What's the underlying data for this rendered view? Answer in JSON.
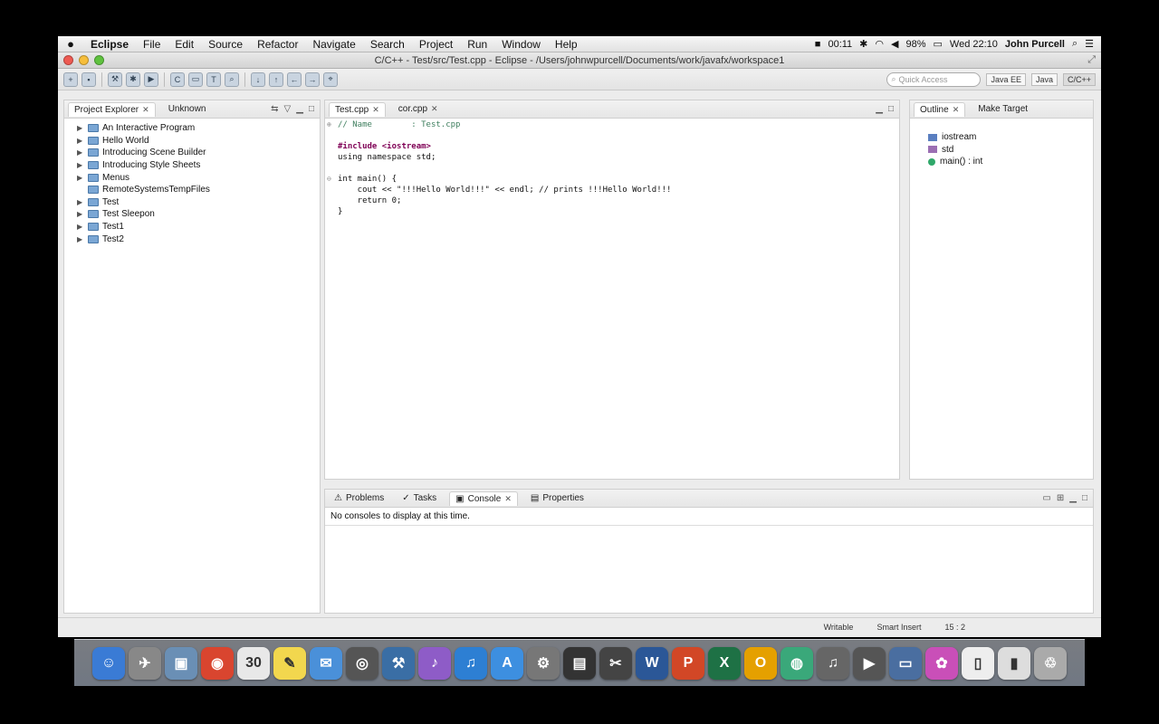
{
  "menubar": {
    "apple": "",
    "items": [
      "Eclipse",
      "File",
      "Edit",
      "Source",
      "Refactor",
      "Navigate",
      "Search",
      "Project",
      "Run",
      "Window",
      "Help"
    ],
    "clock": "00:11",
    "battery": "98%",
    "datetime": "Wed 22:10",
    "user": "John Purcell"
  },
  "window": {
    "title": "C/C++ - Test/src/Test.cpp - Eclipse - /Users/johnwpurcell/Documents/work/javafx/workspace1"
  },
  "toolbar": {
    "quick_access_placeholder": "Quick Access",
    "perspectives": [
      "Java EE",
      "Java",
      "C/C++"
    ]
  },
  "explorer": {
    "tabs": [
      "Project Explorer",
      "Unknown"
    ],
    "items": [
      {
        "label": "An Interactive Program",
        "has_arrow": true
      },
      {
        "label": "Hello World",
        "has_arrow": true
      },
      {
        "label": "Introducing Scene Builder",
        "has_arrow": true
      },
      {
        "label": "Introducing Style Sheets",
        "has_arrow": true
      },
      {
        "label": "Menus",
        "has_arrow": true
      },
      {
        "label": "RemoteSystemsTempFiles",
        "has_arrow": false
      },
      {
        "label": "Test",
        "has_arrow": true
      },
      {
        "label": "Test Sleepon",
        "has_arrow": true
      },
      {
        "label": "Test1",
        "has_arrow": true
      },
      {
        "label": "Test2",
        "has_arrow": true
      }
    ]
  },
  "editor": {
    "tabs": [
      "Test.cpp",
      "cor.cpp"
    ],
    "code": {
      "line1_comment": "// Name        : Test.cpp",
      "include": "#include <iostream>",
      "using": "using namespace std;",
      "main_sig": "int main() {",
      "cout": "    cout << \"!!!Hello World!!!\" << endl; // prints !!!Hello World!!!",
      "return": "    return 0;",
      "close": "}"
    }
  },
  "outline": {
    "tabs": [
      "Outline",
      "Make Target"
    ],
    "items": [
      "iostream",
      "std",
      "main() : int"
    ]
  },
  "console": {
    "tabs": [
      "Problems",
      "Tasks",
      "Console",
      "Properties"
    ],
    "message": "No consoles to display at this time."
  },
  "statusbar": {
    "writable": "Writable",
    "insert": "Smart Insert",
    "position": "15 : 2"
  },
  "dock": {
    "apps": [
      {
        "icon": "finder-icon",
        "color": "#3a7bd5",
        "glyph": "☺"
      },
      {
        "icon": "launchpad-icon",
        "color": "#888888",
        "glyph": "✈"
      },
      {
        "icon": "preview-icon",
        "color": "#6a8fb5",
        "glyph": "▣"
      },
      {
        "icon": "chrome-icon",
        "color": "#d9452f",
        "glyph": "◉"
      },
      {
        "icon": "calendar-icon",
        "color": "#e8e8e8",
        "glyph": "30"
      },
      {
        "icon": "notes-icon",
        "color": "#f2d74e",
        "glyph": "✎"
      },
      {
        "icon": "mail-icon",
        "color": "#4a90d9",
        "glyph": "✉"
      },
      {
        "icon": "camera-icon",
        "color": "#555555",
        "glyph": "◎"
      },
      {
        "icon": "xcode-icon",
        "color": "#3a6ea5",
        "glyph": "⚒"
      },
      {
        "icon": "itunes-icon",
        "color": "#8e5cc7",
        "glyph": "♪"
      },
      {
        "icon": "music-icon",
        "color": "#2d7fd3",
        "glyph": "♫"
      },
      {
        "icon": "appstore-icon",
        "color": "#3d8fe0",
        "glyph": "A"
      },
      {
        "icon": "settings-icon",
        "color": "#777777",
        "glyph": "⚙"
      },
      {
        "icon": "photo-icon",
        "color": "#333333",
        "glyph": "▤"
      },
      {
        "icon": "tools-icon",
        "color": "#444444",
        "glyph": "✂"
      },
      {
        "icon": "word-icon",
        "color": "#2b5797",
        "glyph": "W"
      },
      {
        "icon": "powerpoint-icon",
        "color": "#d24726",
        "glyph": "P"
      },
      {
        "icon": "excel-icon",
        "color": "#1e7145",
        "glyph": "X"
      },
      {
        "icon": "outlook-icon",
        "color": "#e5a000",
        "glyph": "O"
      },
      {
        "icon": "network-icon",
        "color": "#3aa87a",
        "glyph": "◍"
      },
      {
        "icon": "mic-icon",
        "color": "#666666",
        "glyph": "♫"
      },
      {
        "icon": "video-icon",
        "color": "#555555",
        "glyph": "▶"
      },
      {
        "icon": "terminal-icon",
        "color": "#4a6ea0",
        "glyph": "▭"
      },
      {
        "icon": "palette-icon",
        "color": "#c94fb8",
        "glyph": "✿"
      },
      {
        "icon": "document-icon",
        "color": "#eeeeee",
        "glyph": "▯"
      },
      {
        "icon": "folder-icon",
        "color": "#dddddd",
        "glyph": "▮"
      },
      {
        "icon": "trash-icon",
        "color": "#aaaaaa",
        "glyph": "♲"
      }
    ]
  }
}
